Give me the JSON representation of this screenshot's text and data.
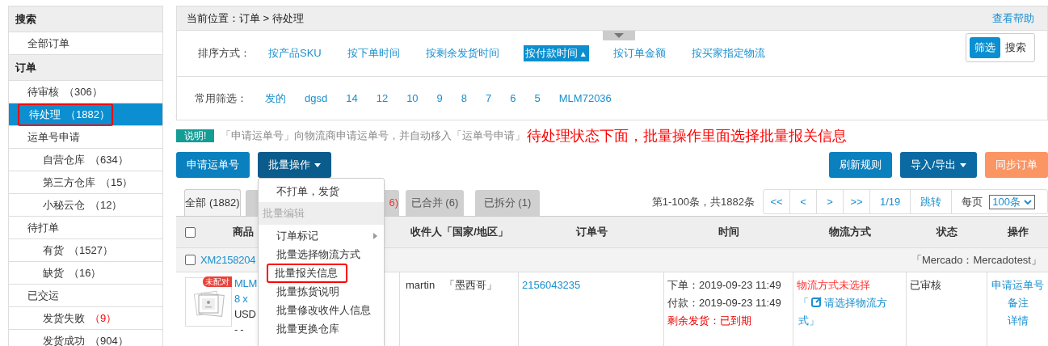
{
  "sidebar": {
    "sections": [
      {
        "title": "搜索",
        "items": [
          {
            "label": "全部订单",
            "selected": false,
            "highlighted": false
          }
        ]
      },
      {
        "title": "订单",
        "items": [
          {
            "label": "待审核",
            "count": "（306）",
            "selected": false,
            "highlighted": false
          },
          {
            "label": "待处理",
            "count": "（1882）",
            "selected": true,
            "highlighted": true
          },
          {
            "label": "运单号申请",
            "selected": false,
            "highlighted": false,
            "children": [
              {
                "label": "自营仓库",
                "count": "（634）",
                "selected": false,
                "highlighted": false
              },
              {
                "label": "第三方仓库",
                "count": "（15）",
                "selected": false,
                "highlighted": false
              },
              {
                "label": "小秘云仓",
                "count": "（12）",
                "selected": false,
                "highlighted": false
              }
            ]
          },
          {
            "label": "待打单",
            "selected": false,
            "highlighted": false,
            "children": [
              {
                "label": "有货",
                "count": "（1527）",
                "selected": false,
                "highlighted": false
              },
              {
                "label": "缺货",
                "count": "（16）",
                "selected": false,
                "highlighted": false
              }
            ]
          },
          {
            "label": "已交运",
            "selected": false,
            "highlighted": false,
            "children": [
              {
                "label": "发货失败",
                "count": "（9）",
                "alert": true,
                "selected": false,
                "highlighted": false
              },
              {
                "label": "发货成功",
                "count": "（904）",
                "selected": false,
                "highlighted": false
              }
            ]
          }
        ]
      }
    ]
  },
  "breadcrumb": {
    "label": "当前位置：",
    "path": "订单 > 待处理"
  },
  "help_link": "查看帮助",
  "sort": {
    "label": "排序方式：",
    "options": [
      {
        "label": "按产品SKU",
        "selected": false
      },
      {
        "label": "按下单时间",
        "selected": false
      },
      {
        "label": "按剩余发货时间",
        "selected": false
      },
      {
        "label": "按付款时间",
        "arrow": "▲",
        "selected": true
      },
      {
        "label": "按订单金额",
        "selected": false
      },
      {
        "label": "按买家指定物流",
        "selected": false
      }
    ]
  },
  "mode_toggle": [
    {
      "label": "筛选",
      "selected": true
    },
    {
      "label": "搜索",
      "selected": false
    }
  ],
  "filters": {
    "label": "常用筛选：",
    "items": [
      "发的",
      "dgsd",
      "14",
      "12",
      "10",
      "9",
      "8",
      "7",
      "6",
      "5",
      "MLM72036"
    ]
  },
  "notice": {
    "badge": "说明!",
    "text": "「申请运单号」向物流商申请运单号，并自动移入「运单号申请」",
    "annotation": "待处理状态下面，批量操作里面选择批量报关信息"
  },
  "toolbar_left": [
    {
      "label": "申请运单号",
      "kind": "primary"
    },
    {
      "label": "批量操作",
      "kind": "dropdown",
      "expanded": true
    }
  ],
  "toolbar_right": [
    {
      "label": "刷新规则",
      "kind": "primary"
    },
    {
      "label": "导入/导出",
      "kind": "dropdown",
      "expanded": false
    },
    {
      "label": "同步订单",
      "kind": "sync"
    }
  ],
  "menu": [
    {
      "label": "不打单，发货",
      "kind": "item",
      "highlighted": false
    },
    {
      "label": "批量编辑",
      "kind": "header"
    },
    {
      "label": "订单标记",
      "kind": "submenu",
      "highlighted": false
    },
    {
      "label": "批量选择物流方式",
      "kind": "item",
      "highlighted": false
    },
    {
      "label": "批量报关信息",
      "kind": "item",
      "highlighted": true
    },
    {
      "label": "批量拣货说明",
      "kind": "item",
      "highlighted": false
    },
    {
      "label": "批量修改收件人信息",
      "kind": "item",
      "highlighted": false
    },
    {
      "label": "批量更换仓库",
      "kind": "item",
      "highlighted": false
    }
  ],
  "tabs": [
    {
      "label": "全部 (1882)",
      "selected": true,
      "alert": false
    },
    {
      "label": "6)",
      "selected": false,
      "alert": true
    },
    {
      "label": "已合并 (6)",
      "selected": false,
      "alert": false
    },
    {
      "label": "已拆分 (1)",
      "selected": false,
      "alert": false
    }
  ],
  "pager": {
    "summary": "第1-100条，共1882条",
    "buttons": [
      "<<",
      "<",
      ">",
      ">>"
    ],
    "page": "1/19",
    "jump": "跳转",
    "per_page_label": "每页",
    "per_page": "100条"
  },
  "table": {
    "select_all": false,
    "columns": [
      "商品",
      "收件人「国家/地区」",
      "订单号",
      "时间",
      "物流方式",
      "状态",
      "操作"
    ],
    "orders": [
      {
        "order_id": "XM2158204",
        "checked": false,
        "store": "「Mercado：Mercadotest」",
        "badge": "未配对",
        "product_lines": [
          "MLM",
          "8 x",
          "USD",
          "- -"
        ],
        "recipient": "martin",
        "country": "「墨西哥」",
        "order_no": "2156043235",
        "times": [
          {
            "text": "下单：2019-09-23 11:49",
            "alert": false
          },
          {
            "text": "付款：2019-09-23 11:49",
            "alert": false
          },
          {
            "text": "剩余发货：已到期",
            "alert": true
          }
        ],
        "logistics": {
          "warning": "物流方式未选择",
          "link_open": "「",
          "link": "请选择物流方式」"
        },
        "status": "已审核",
        "actions": [
          "申请运单号",
          "备注",
          "详情"
        ]
      }
    ]
  }
}
